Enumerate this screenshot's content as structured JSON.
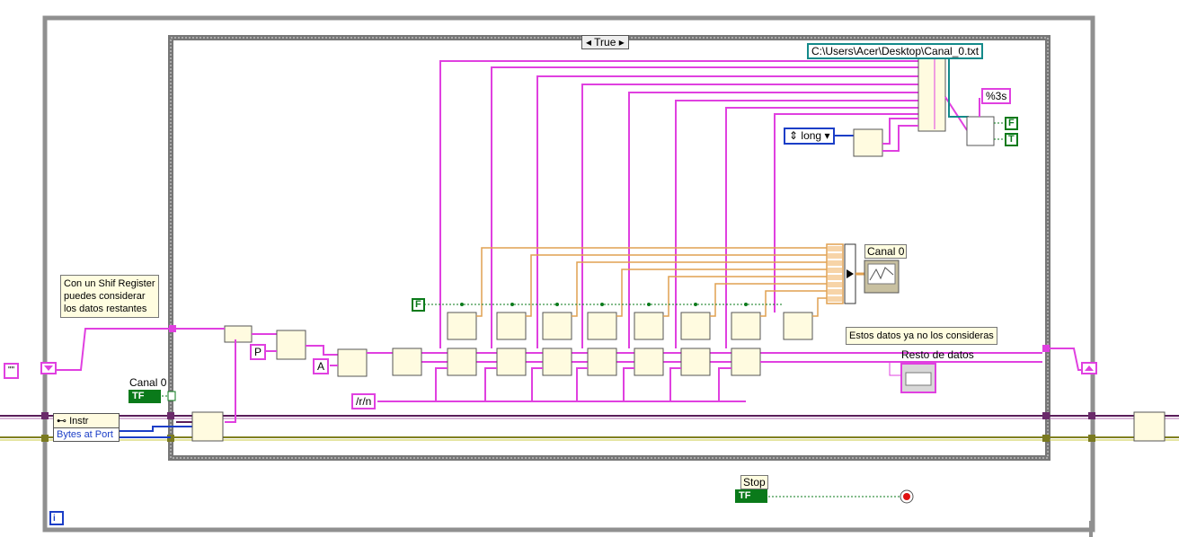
{
  "case_selector": {
    "value": "True"
  },
  "file_path": "C:\\Users\\Acer\\Desktop\\Canal_0.txt",
  "format_string": "%3s",
  "enum_constant": "long",
  "comment_shift_register": [
    "Con un Shif Register",
    "puedes considerar",
    "los datos restantes"
  ],
  "comment_discard": "Estos datos ya no los consideras",
  "label_resto": "Resto de datos",
  "label_canal0_graph": "Canal 0",
  "label_canal0_bool": "Canal 0",
  "label_stop": "Stop",
  "const_p": "P",
  "const_a": "A",
  "const_rn": "/r/n",
  "const_empty_string": "\"\"",
  "const_false": "F",
  "const_true": "T",
  "property_node": {
    "title": "Instr",
    "property": "Bytes at Port"
  },
  "bool_indicator_text": "TF",
  "loop_iteration_label": "i",
  "colors": {
    "wire_string": "#e040e0",
    "wire_number": "#e0a050",
    "wire_bool": "#0a7a1a",
    "frame": "#909090"
  }
}
